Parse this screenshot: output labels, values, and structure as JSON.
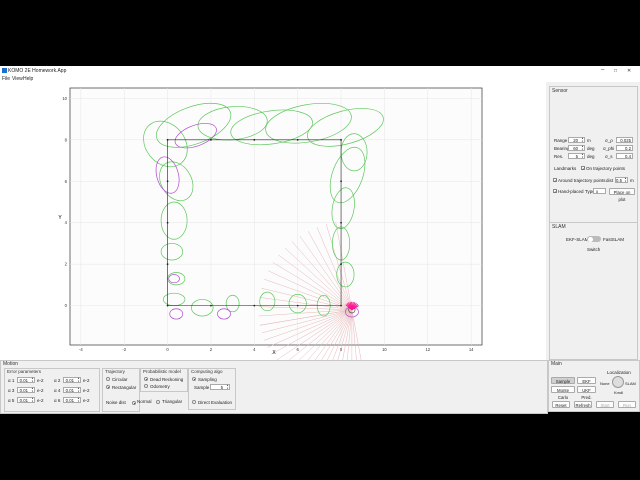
{
  "window": {
    "title": "KOMO 2E Homework.App",
    "min": "–",
    "max": "□",
    "close": "✕"
  },
  "menu": [
    "File",
    "View",
    "Help"
  ],
  "plot": {
    "xlabel": "X",
    "ylabel": "Y",
    "xticks": [
      "-4",
      "-2",
      "0",
      "2",
      "4",
      "6",
      "8",
      "10",
      "12",
      "14"
    ],
    "yticks": [
      "0",
      "2",
      "4",
      "6",
      "8",
      "10"
    ],
    "xlim": [
      -4.5,
      14.5
    ],
    "ylim": [
      -1.9,
      10.5
    ],
    "grid": true,
    "trajectory": [
      [
        0,
        0
      ],
      [
        8,
        0
      ],
      [
        8,
        8
      ],
      [
        0,
        8
      ],
      [
        0,
        0
      ]
    ],
    "landmarks": [
      [
        0,
        8
      ],
      [
        2,
        8
      ],
      [
        4,
        8
      ],
      [
        6,
        8
      ],
      [
        8,
        8
      ],
      [
        8,
        6
      ],
      [
        8,
        4
      ],
      [
        8,
        2
      ],
      [
        8,
        0
      ],
      [
        6,
        0
      ],
      [
        4,
        0
      ],
      [
        2,
        0
      ],
      [
        0,
        0
      ],
      [
        0,
        2
      ],
      [
        0,
        4
      ],
      [
        0,
        6
      ]
    ],
    "robot": [
      8.5,
      -0.2
    ],
    "colors": {
      "green": "#5cc85c",
      "purple": "#b04ad0",
      "magenta": "#ff1493",
      "sensor": "#e8b8b8",
      "trajectory": "#222222"
    }
  },
  "sensor": {
    "title": "Sensor",
    "range_label": "Range",
    "range_value": "20",
    "range_unit": "m",
    "bearing_label": "Bearing",
    "bearing_value": "60",
    "bearing_unit": "deg",
    "res_label": "Res.",
    "res_value": "5",
    "res_unit": "deg",
    "sigma_r_label": "σ_ρ",
    "sigma_r_value": "0.025",
    "sigma_phi_label": "σ_phi",
    "sigma_phi_value": "0.2",
    "sigma_s_label": "σ_s",
    "sigma_s_value": "0.4",
    "landmarks_label": "Landmarks",
    "on_traj_label": "On trajectory points",
    "around_traj_label": "Around trajectory points",
    "dist_label": "dist",
    "dist_value": "0.5",
    "dist_unit": "m",
    "hand_placed_label": "Hand-placed",
    "type_label": "Type",
    "type_value": "x",
    "place_button": "Place on plot"
  },
  "slam": {
    "title": "SLAM",
    "ekf_label": "EKF-SLAM",
    "fast_label": "FastSLAM",
    "switch_label": "Switch"
  },
  "motion": {
    "title": "Motion",
    "error_title": "Error parameters",
    "params": [
      {
        "name": "α 1",
        "value": "0.01",
        "exp": "e-2"
      },
      {
        "name": "α 2",
        "value": "0.01",
        "exp": "e-2"
      },
      {
        "name": "α 3",
        "value": "0.01",
        "exp": "e-2"
      },
      {
        "name": "α 4",
        "value": "0.01",
        "exp": "e-2"
      },
      {
        "name": "α 5",
        "value": "0.01",
        "exp": "e-2"
      },
      {
        "name": "α 6",
        "value": "0.01",
        "exp": "e-2"
      }
    ],
    "traj_title": "Trajectory",
    "circular": "Circular",
    "rectangular": "Rectangular",
    "noise_dist": "Noise dist",
    "normal": "Normal",
    "triangular": "Triangular",
    "prob_title": "Probabilistic model",
    "dead_reckoning": "Dead Reckoning",
    "odometry": "Odometry",
    "algo_title": "Computing algo",
    "sampling": "Sampling",
    "sample_label": "Sample",
    "sample_value": "5",
    "direct_eval": "Direct Evaluation"
  },
  "main_panel": {
    "title": "Main",
    "sample_pdfs": "Sample Pdfs",
    "ekf_pred": "EKF Pred.",
    "monte_carlo": "Monte Carlo",
    "ukf_pred": "UKF Pred.",
    "localization": "Localization",
    "none": "None",
    "slam": "SLAM",
    "kmdl": "Kmdl",
    "reset": "Reset",
    "refresh": "Refresh",
    "start": "Start",
    "run": "Run"
  }
}
